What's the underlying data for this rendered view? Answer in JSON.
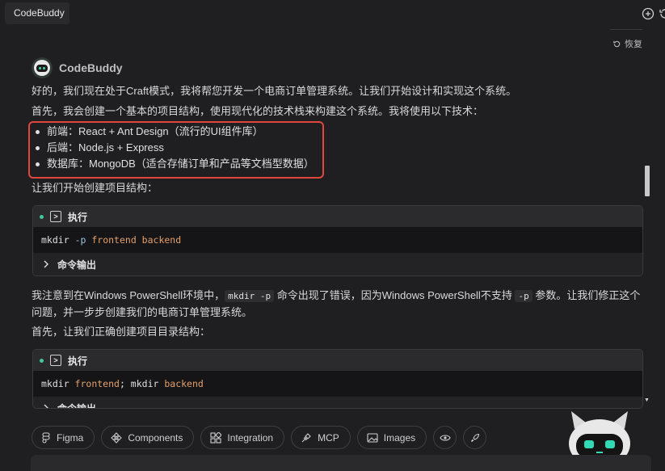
{
  "window": {
    "tab_label": "CodeBuddy",
    "icons": [
      "add-chat-icon",
      "history-icon"
    ]
  },
  "restore_label": "恢复",
  "agent": {
    "name": "CodeBuddy",
    "avatar_icon": "robot-avatar-icon"
  },
  "message": {
    "para1": "好的，我们现在处于Craft模式，我将帮您开发一个电商订单管理系统。让我们开始设计和实现这个系统。",
    "para2": "首先，我会创建一个基本的项目结构，使用现代化的技术栈来构建这个系统。我将使用以下技术：",
    "bullets": [
      "前端：React + Ant Design（流行的UI组件库）",
      "后端：Node.js + Express",
      "数据库：MongoDB（适合存储订单和产品等文档型数据）"
    ],
    "para3": "让我们开始创建项目结构：",
    "block1": {
      "header": "执行",
      "cmd_main": "mkdir",
      "cmd_flag": "-p",
      "cmd_args": "frontend backend",
      "output_label": "命令输出"
    },
    "para4_a": "我注意到在Windows PowerShell环境中，",
    "para4_code1": "mkdir -p",
    "para4_b": "命令出现了错误，因为Windows PowerShell不支持",
    "para4_code2": "-p",
    "para4_c": "参数。让我们修正这个问题，并一步步创建我们的电商订单管理系统。",
    "para5": "首先，让我们正确创建项目目录结构：",
    "block2": {
      "header": "执行",
      "cmd_p1": "mkdir",
      "cmd_p2": "frontend",
      "cmd_p3": "; mkdir",
      "cmd_p4": "backend",
      "output_label": "命令输出"
    }
  },
  "chips": {
    "figma": "Figma",
    "components": "Components",
    "integration": "Integration",
    "mcp": "MCP",
    "images": "Images"
  },
  "colors": {
    "background": "#1f1f21",
    "highlight_border": "#e0483f",
    "status_dot": "#43c59e",
    "code_arg": "#e6a06a"
  }
}
